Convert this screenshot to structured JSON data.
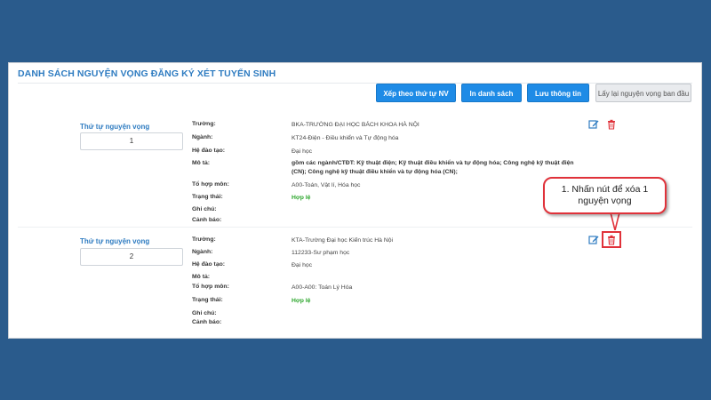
{
  "page": {
    "title": "DANH SÁCH NGUYỆN VỌNG ĐĂNG KÝ XÉT TUYỂN SINH"
  },
  "toolbar": {
    "sort_label": "Xếp theo thứ tự NV",
    "print_label": "In danh sách",
    "save_label": "Lưu thông tin",
    "restore_label": "Lấy lại nguyện vọng ban đầu"
  },
  "labels": {
    "order": "Thứ tự nguyện vọng",
    "school": "Trường:",
    "major": "Ngành:",
    "training": "Hệ đào tạo:",
    "description": "Mô tả:",
    "combination": "Tổ hợp môn:",
    "status": "Trạng thái:",
    "note": "Ghi chú:",
    "warning": "Cảnh báo:"
  },
  "records": [
    {
      "order": "1",
      "school": "BKA-TRƯỜNG ĐẠI HỌC BÁCH KHOA HÀ NỘI",
      "major": "KT24-Điện - Điều khiển và Tự động hóa",
      "training": "Đại học",
      "description": "gồm các ngành/CTĐT: Kỹ thuật điện; Kỹ thuật điều khiển và tự động hóa; Công nghệ kỹ thuật điện (CN); Công nghệ kỹ thuật điều khiển và tự động hóa (CN);",
      "combination": "A00-Toán, Vật lí, Hóa học",
      "status": "Hợp lệ",
      "note": "",
      "warning": ""
    },
    {
      "order": "2",
      "school": "KTA-Trường Đại học Kiến trúc Hà Nội",
      "major": "112233-Sư phạm học",
      "training": "Đại học",
      "description": "",
      "combination": "A00-A00: Toán Lý Hóa",
      "status": "Hợp lệ",
      "note": "",
      "warning": ""
    }
  ],
  "callout": {
    "line1": "1. Nhấn nút để xóa 1",
    "line2": "nguyện vọng"
  },
  "colors": {
    "background": "#2a5b8c",
    "accent": "#1e8be6",
    "title": "#2f7cc1",
    "valid": "#2aa52a",
    "delete": "#e0323a"
  },
  "icons": [
    "edit-icon",
    "trash-icon"
  ]
}
